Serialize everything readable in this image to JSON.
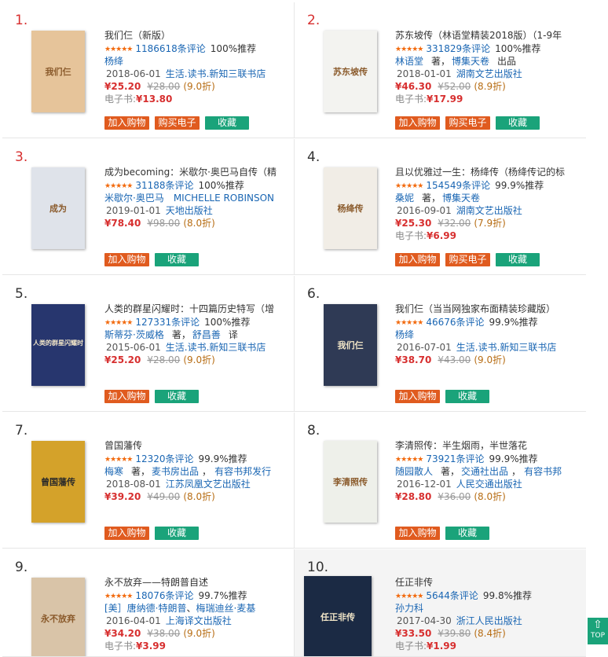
{
  "items": [
    {
      "rank": "1.",
      "title": "我们仨（新版）",
      "comments": "1186618条评论",
      "recommend": "100%推荐",
      "author": "杨绛",
      "date": "2018-06-01",
      "press": "生活.读书.新知三联书店",
      "price": "¥25.20",
      "orig": "¥28.00",
      "discount": "(9.0折)",
      "ebook_label": "电子书:",
      "ebook_price": "¥13.80",
      "cover_text": "我们仨",
      "cover_bg": "#e6c49a"
    },
    {
      "rank": "2.",
      "title": "苏东坡传（林语堂精装2018版）（1-9年",
      "comments": "331829条评论",
      "recommend": "100%推荐",
      "author": "林语堂",
      "author_role": "著，",
      "author2": "博集天卷",
      "author_role2": "出品",
      "date": "2018-01-01",
      "press": "湖南文艺出版社",
      "price": "¥46.30",
      "orig": "¥52.00",
      "discount": "(8.9折)",
      "ebook_label": "电子书:",
      "ebook_price": "¥17.99",
      "cover_text": "苏东坡传",
      "cover_bg": "#f3f3f0"
    },
    {
      "rank": "3.",
      "title": "成为becoming：米歇尔·奥巴马自传（精",
      "comments": "31188条评论",
      "recommend": "100%推荐",
      "author": "米歇尔·奥巴马　MICHELLE ROBINSON",
      "date": "2019-01-01",
      "press": "天地出版社",
      "price": "¥78.40",
      "orig": "¥98.00",
      "discount": "(8.0折)",
      "cover_text": "成为",
      "cover_bg": "#dfe3ea"
    },
    {
      "rank": "4.",
      "title": "且以优雅过一生：杨绛传（杨绛传记的标",
      "comments": "154549条评论",
      "recommend": "99.9%推荐",
      "author": "桑妮",
      "author_role": "著，",
      "author2": "博集天卷",
      "date": "2016-09-01",
      "press": "湖南文艺出版社",
      "price": "¥25.30",
      "orig": "¥32.00",
      "discount": "(7.9折)",
      "ebook_label": "电子书:",
      "ebook_price": "¥6.99",
      "cover_text": "杨绛传",
      "cover_bg": "#f1ede6"
    },
    {
      "rank": "5.",
      "title": "人类的群星闪耀时：十四篇历史特写（增",
      "comments": "127331条评论",
      "recommend": "100%推荐",
      "author": "斯蒂芬·茨威格",
      "author_role": "著，",
      "author2": "舒昌善",
      "author_role2": "译",
      "date": "2015-06-01",
      "press": "生活.读书.新知三联书店",
      "price": "¥25.20",
      "orig": "¥28.00",
      "discount": "(9.0折)",
      "cover_text": "人类的群星闪耀时",
      "cover_bg": "#27366e"
    },
    {
      "rank": "6.",
      "title": "我们仨（当当网独家布面精装珍藏版）",
      "comments": "46676条评论",
      "recommend": "99.9%推荐",
      "author": "杨绛",
      "date": "2016-07-01",
      "press": "生活.读书.新知三联书店",
      "price": "¥38.70",
      "orig": "¥43.00",
      "discount": "(9.0折)",
      "cover_text": "我们仨",
      "cover_bg": "#2f3a55"
    },
    {
      "rank": "7.",
      "title": "曾国藩传",
      "comments": "12320条评论",
      "recommend": "99.9%推荐",
      "author": "梅寒",
      "author_role": "著，",
      "author2": "麦书房出品",
      "author_sep": "，",
      "author3": "有容书邦发行",
      "date": "2018-08-01",
      "press": "江苏凤凰文艺出版社",
      "price": "¥39.20",
      "orig": "¥49.00",
      "discount": "(8.0折)",
      "cover_text": "曾国藩传",
      "cover_bg": "#d4a22a"
    },
    {
      "rank": "8.",
      "title": "李清照传：半生烟雨，半世落花",
      "comments": "73921条评论",
      "recommend": "99.9%推荐",
      "author": "随园散人",
      "author_role": "著，",
      "author2": "交通社出品",
      "author_sep": "，",
      "author3": "有容书邦",
      "date": "2016-12-01",
      "press": "人民交通出版社",
      "price": "¥28.80",
      "orig": "¥36.00",
      "discount": "(8.0折)",
      "cover_text": "李清照传",
      "cover_bg": "#eef0ea"
    },
    {
      "rank": "9.",
      "title": "永不放弃——特朗普自述",
      "comments": "18076条评论",
      "recommend": "99.7%推荐",
      "author": "[美］唐纳德·特朗普",
      "author_sep": "、",
      "author2": "梅瑞迪丝·麦基",
      "date": "2016-04-01",
      "press": "上海译文出版社",
      "price": "¥34.20",
      "orig": "¥38.00",
      "discount": "(9.0折)",
      "ebook_label": "电子书:",
      "ebook_price": "¥3.99",
      "cover_text": "永不放弃",
      "cover_bg": "#d9c4a8"
    },
    {
      "rank": "10.",
      "title": "任正非传",
      "comments": "5644条评论",
      "recommend": "99.8%推荐",
      "author": "孙力科",
      "date": "2017-04-30",
      "press": "浙江人民出版社",
      "price": "¥33.50",
      "orig": "¥39.80",
      "discount": "(8.4折)",
      "ebook_label": "电子书:",
      "ebook_price": "¥1.99",
      "cover_text": "任正非传",
      "cover_bg": "#1b2a44"
    }
  ],
  "stars": "★★★★★",
  "labels": {
    "cart": "加入购物",
    "buy_ebook": "购买电子",
    "favorite": "收藏",
    "top": "TOP"
  },
  "colors": {
    "accent_red": "#d72f2f",
    "button_orange": "#e05b1f",
    "button_green": "#1aa37a",
    "link_blue": "#1a66b3"
  }
}
